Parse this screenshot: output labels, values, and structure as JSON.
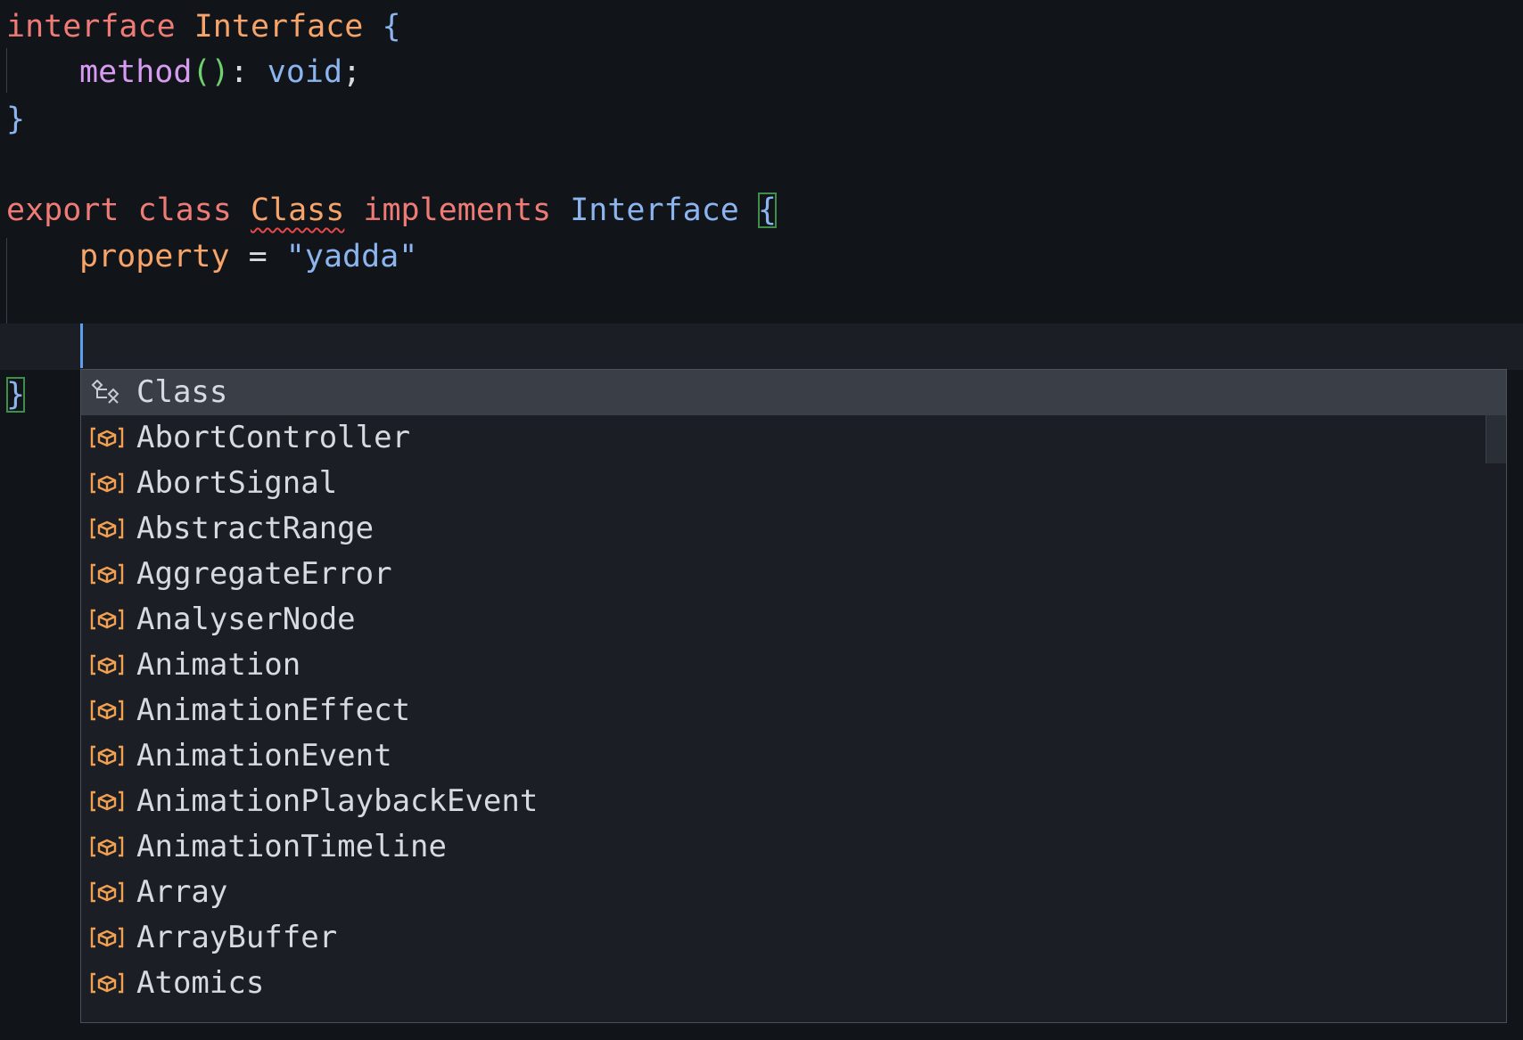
{
  "editor": {
    "lines": [
      {
        "id": "l1",
        "tokens": [
          "interface",
          " ",
          "Interface",
          " ",
          "{"
        ]
      },
      {
        "id": "l2",
        "tokens": [
          "method",
          "()",
          ": ",
          "void",
          ";"
        ]
      },
      {
        "id": "l3",
        "tokens": [
          "}"
        ]
      },
      {
        "id": "l4",
        "tokens": [
          "export",
          " ",
          "class",
          " ",
          "Class",
          " ",
          "implements",
          " ",
          "Interface",
          " ",
          "{"
        ]
      },
      {
        "id": "l5",
        "tokens": [
          "property",
          " = ",
          "\"yadda\""
        ]
      },
      {
        "id": "l6",
        "tokens": [
          "}"
        ]
      }
    ],
    "error_token": "Class",
    "colors": {
      "keyword": "#ef7b77",
      "type": "#f6a46a",
      "interface_ref": "#8cb5f0",
      "method": "#d79cf2",
      "paren": "#6fd06f",
      "string": "#8cb5f0",
      "background": "#111418"
    }
  },
  "suggest": {
    "selected_index": 0,
    "items": [
      {
        "label": "Class",
        "kind": "class-icon"
      },
      {
        "label": "AbortController",
        "kind": "variable-icon"
      },
      {
        "label": "AbortSignal",
        "kind": "variable-icon"
      },
      {
        "label": "AbstractRange",
        "kind": "variable-icon"
      },
      {
        "label": "AggregateError",
        "kind": "variable-icon"
      },
      {
        "label": "AnalyserNode",
        "kind": "variable-icon"
      },
      {
        "label": "Animation",
        "kind": "variable-icon"
      },
      {
        "label": "AnimationEffect",
        "kind": "variable-icon"
      },
      {
        "label": "AnimationEvent",
        "kind": "variable-icon"
      },
      {
        "label": "AnimationPlaybackEvent",
        "kind": "variable-icon"
      },
      {
        "label": "AnimationTimeline",
        "kind": "variable-icon"
      },
      {
        "label": "Array",
        "kind": "variable-icon"
      },
      {
        "label": "ArrayBuffer",
        "kind": "variable-icon"
      },
      {
        "label": "Atomics",
        "kind": "variable-icon"
      }
    ],
    "colors": {
      "variable_icon": "#f0a050",
      "selected_bg": "#3a3e46",
      "widget_bg": "#1b1e24"
    }
  }
}
